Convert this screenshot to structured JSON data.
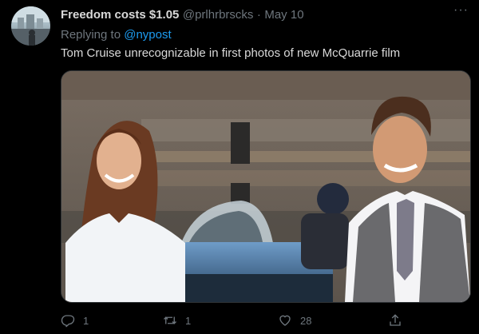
{
  "tweet": {
    "display_name": "Freedom costs $1.05",
    "handle": "@prlhrbrscks",
    "separator": "·",
    "date": "May 10",
    "more_label": "···",
    "replying_prefix": "Replying to",
    "replying_to": "@nypost",
    "text": "Tom Cruise unrecognizable in first photos of new McQuarrie film"
  },
  "actions": {
    "reply_count": "1",
    "retweet_count": "1",
    "like_count": "28"
  },
  "icons": {
    "reply": "reply-icon",
    "retweet": "retweet-icon",
    "like": "heart-icon",
    "share": "share-icon",
    "more": "more-icon"
  },
  "colors": {
    "background": "#000000",
    "primary_text": "#d9d9d9",
    "secondary_text": "#6e767d",
    "link": "#1d9bf0"
  }
}
